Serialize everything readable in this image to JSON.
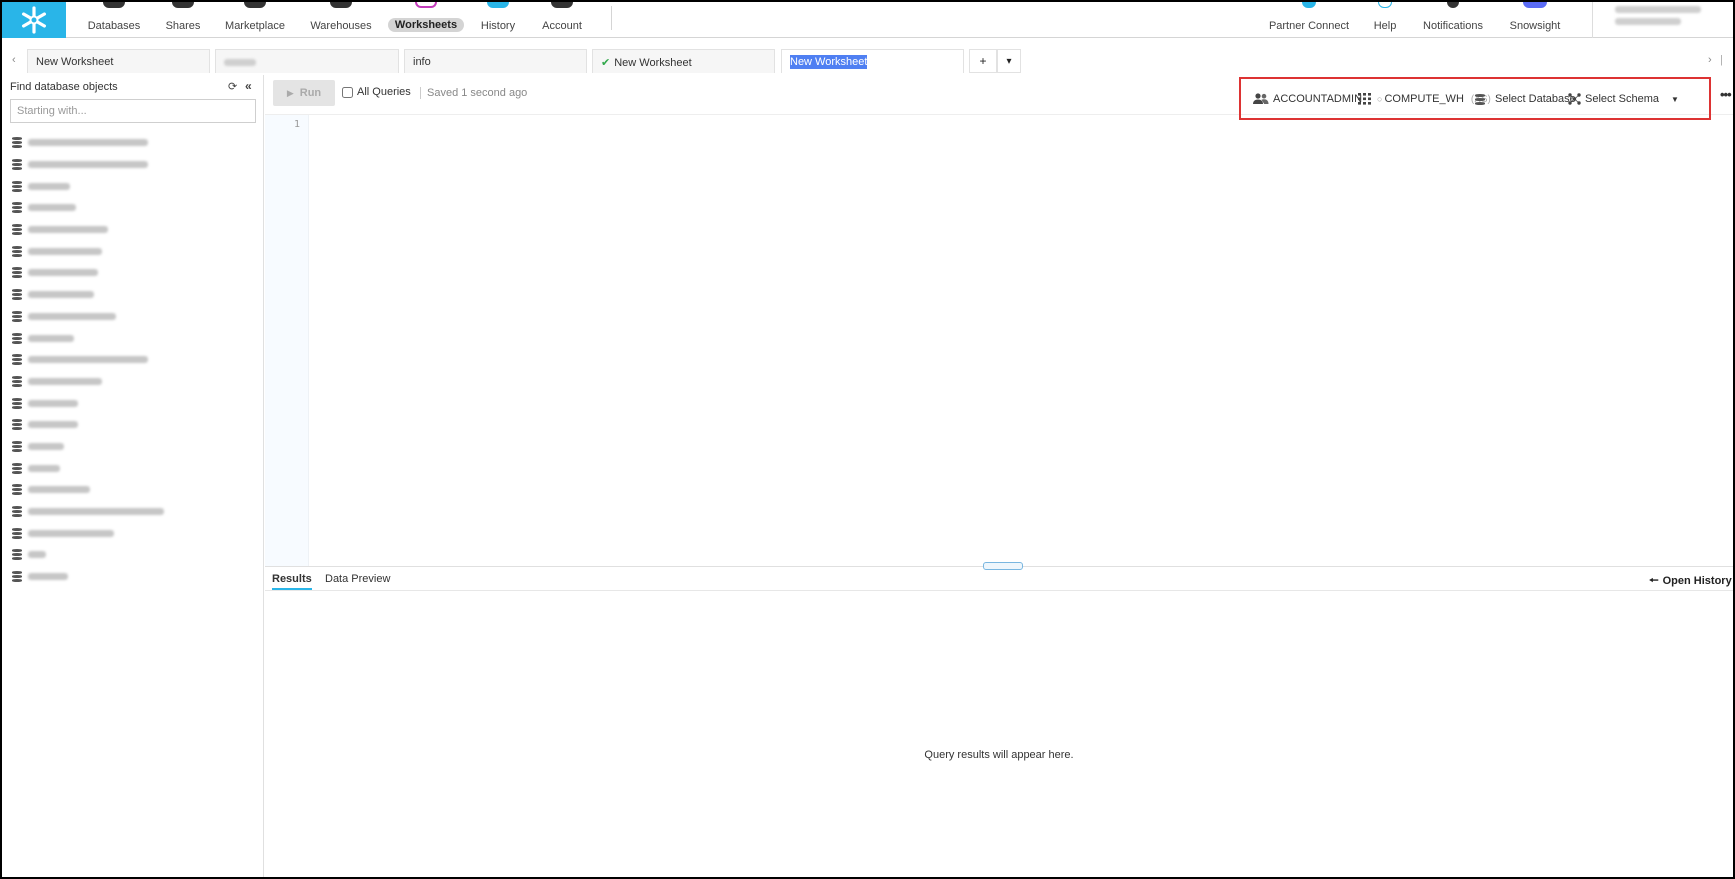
{
  "nav": {
    "items": [
      {
        "label": "Databases"
      },
      {
        "label": "Shares"
      },
      {
        "label": "Marketplace"
      },
      {
        "label": "Warehouses"
      },
      {
        "label": "Worksheets",
        "active": true
      },
      {
        "label": "History"
      },
      {
        "label": "Account"
      }
    ],
    "right_items": [
      {
        "label": "Partner Connect"
      },
      {
        "label": "Help"
      },
      {
        "label": "Notifications"
      },
      {
        "label": "Snowsight"
      }
    ]
  },
  "tabs": [
    {
      "label": "New Worksheet"
    },
    {
      "label": ""
    },
    {
      "label": "info"
    },
    {
      "label": "New Worksheet",
      "saved": true
    },
    {
      "label": "New Worksheet",
      "active": true
    }
  ],
  "tab_controls": {
    "add": "+",
    "menu": "▾"
  },
  "sidebar": {
    "heading": "Find database objects",
    "search_placeholder": "Starting with...",
    "databases": [
      {
        "name": ""
      },
      {
        "name": ""
      },
      {
        "name": ""
      },
      {
        "name": ""
      },
      {
        "name": ""
      },
      {
        "name": ""
      },
      {
        "name": ""
      },
      {
        "name": ""
      },
      {
        "name": ""
      },
      {
        "name": ""
      },
      {
        "name": ""
      },
      {
        "name": ""
      },
      {
        "name": ""
      },
      {
        "name": ""
      },
      {
        "name": ""
      },
      {
        "name": ""
      },
      {
        "name": ""
      },
      {
        "name": ""
      },
      {
        "name": ""
      },
      {
        "name": ""
      },
      {
        "name": ""
      }
    ]
  },
  "toolbar": {
    "run_label": "Run",
    "all_queries_label": "All Queries",
    "saved_status": "Saved 1 second ago",
    "role": "ACCOUNTADMIN",
    "warehouse": "COMPUTE_WH",
    "warehouse_size": "(XS)",
    "database": "Select Database",
    "schema": "Select Schema"
  },
  "editor": {
    "line_number": "1"
  },
  "results": {
    "tabs": [
      "Results",
      "Data Preview"
    ],
    "open_history": "Open History",
    "empty_message": "Query results will appear here."
  },
  "colors": {
    "brand": "#29b5e8",
    "highlight_border": "#dd3333",
    "selection": "#4f7ff2"
  }
}
